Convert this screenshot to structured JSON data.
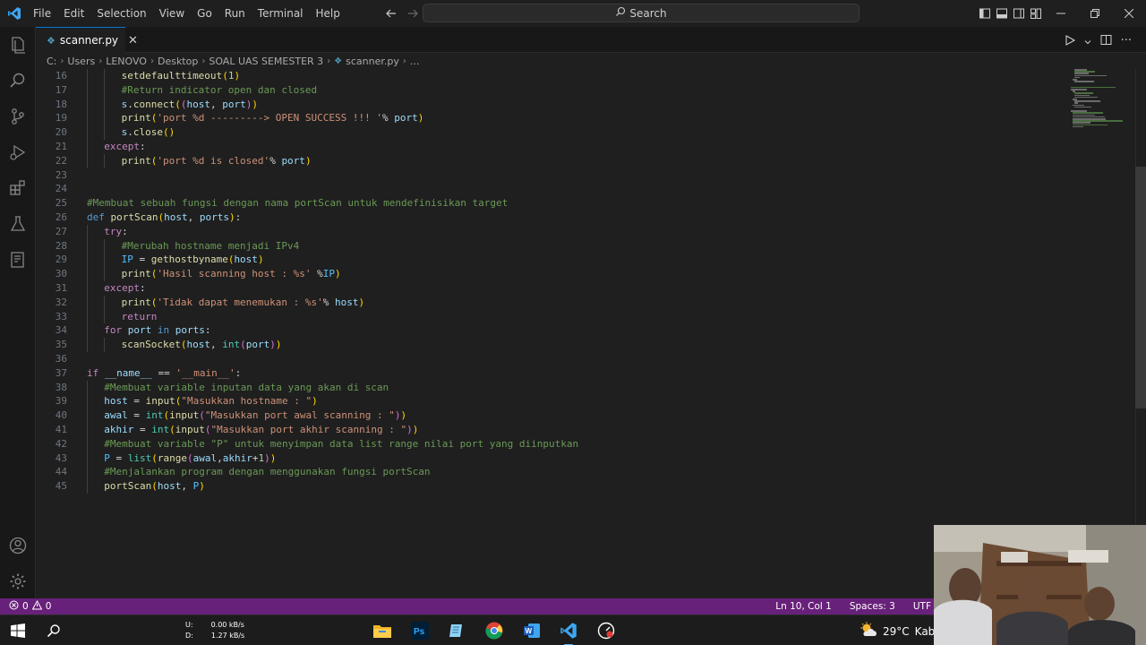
{
  "app": {
    "menu": [
      "File",
      "Edit",
      "Selection",
      "View",
      "Go",
      "Run",
      "Terminal",
      "Help"
    ],
    "search_label": "Search"
  },
  "tab": {
    "filename": "scanner.py"
  },
  "breadcrumb": [
    "C:",
    "Users",
    "LENOVO",
    "Desktop",
    "SOAL UAS SEMESTER 3",
    "scanner.py",
    "..."
  ],
  "code_lines": [
    {
      "n": "16",
      "indent": 2,
      "tokens": [
        [
          "fn",
          "setdefaulttimeout"
        ],
        [
          "p1",
          "("
        ],
        [
          "num",
          "1"
        ],
        [
          "p1",
          ")"
        ]
      ]
    },
    {
      "n": "17",
      "indent": 2,
      "tokens": [
        [
          "cmt",
          "#Return indicator open dan closed"
        ]
      ]
    },
    {
      "n": "18",
      "indent": 2,
      "tokens": [
        [
          "var",
          "s"
        ],
        [
          "d",
          "."
        ],
        [
          "fn",
          "connect"
        ],
        [
          "p1",
          "("
        ],
        [
          "p2",
          "("
        ],
        [
          "var",
          "host"
        ],
        [
          "d",
          ", "
        ],
        [
          "var",
          "port"
        ],
        [
          "p2",
          ")"
        ],
        [
          "p1",
          ")"
        ]
      ]
    },
    {
      "n": "19",
      "indent": 2,
      "tokens": [
        [
          "fn",
          "print"
        ],
        [
          "p1",
          "("
        ],
        [
          "str",
          "'port %d ---------> OPEN SUCCESS !!! '"
        ],
        [
          "d",
          "% "
        ],
        [
          "var",
          "port"
        ],
        [
          "p1",
          ")"
        ]
      ]
    },
    {
      "n": "20",
      "indent": 2,
      "tokens": [
        [
          "var",
          "s"
        ],
        [
          "d",
          "."
        ],
        [
          "fn",
          "close"
        ],
        [
          "p1",
          "()"
        ]
      ]
    },
    {
      "n": "21",
      "indent": 1,
      "tokens": [
        [
          "kw",
          "except"
        ],
        [
          "d",
          ":"
        ]
      ]
    },
    {
      "n": "22",
      "indent": 2,
      "tokens": [
        [
          "fn",
          "print"
        ],
        [
          "p1",
          "("
        ],
        [
          "str",
          "'port %d is closed'"
        ],
        [
          "d",
          "% "
        ],
        [
          "var",
          "port"
        ],
        [
          "p1",
          ")"
        ]
      ]
    },
    {
      "n": "23",
      "indent": 0,
      "tokens": []
    },
    {
      "n": "24",
      "indent": 0,
      "tokens": []
    },
    {
      "n": "25",
      "indent": 0,
      "tokens": [
        [
          "cmt",
          "#Membuat sebuah fungsi dengan nama portScan untuk mendefinisikan target"
        ]
      ]
    },
    {
      "n": "26",
      "indent": 0,
      "tokens": [
        [
          "kw2",
          "def "
        ],
        [
          "fn",
          "portScan"
        ],
        [
          "p1",
          "("
        ],
        [
          "var",
          "host"
        ],
        [
          "d",
          ", "
        ],
        [
          "var",
          "ports"
        ],
        [
          "p1",
          ")"
        ],
        [
          "d",
          ":"
        ]
      ]
    },
    {
      "n": "27",
      "indent": 1,
      "tokens": [
        [
          "kw",
          "try"
        ],
        [
          "d",
          ":"
        ]
      ]
    },
    {
      "n": "28",
      "indent": 2,
      "tokens": [
        [
          "cmt",
          "#Merubah hostname menjadi IPv4"
        ]
      ]
    },
    {
      "n": "29",
      "indent": 2,
      "tokens": [
        [
          "const",
          "IP"
        ],
        [
          "d",
          " = "
        ],
        [
          "fn",
          "gethostbyname"
        ],
        [
          "p1",
          "("
        ],
        [
          "var",
          "host"
        ],
        [
          "p1",
          ")"
        ]
      ]
    },
    {
      "n": "30",
      "indent": 2,
      "tokens": [
        [
          "fn",
          "print"
        ],
        [
          "p1",
          "("
        ],
        [
          "str",
          "'Hasil scanning host : %s'"
        ],
        [
          "d",
          " %"
        ],
        [
          "const",
          "IP"
        ],
        [
          "p1",
          ")"
        ]
      ]
    },
    {
      "n": "31",
      "indent": 1,
      "tokens": [
        [
          "kw",
          "except"
        ],
        [
          "d",
          ":"
        ]
      ]
    },
    {
      "n": "32",
      "indent": 2,
      "tokens": [
        [
          "fn",
          "print"
        ],
        [
          "p1",
          "("
        ],
        [
          "str",
          "'Tidak dapat menemukan : %s'"
        ],
        [
          "d",
          "% "
        ],
        [
          "var",
          "host"
        ],
        [
          "p1",
          ")"
        ]
      ]
    },
    {
      "n": "33",
      "indent": 2,
      "tokens": [
        [
          "kw",
          "return"
        ]
      ]
    },
    {
      "n": "34",
      "indent": 1,
      "tokens": [
        [
          "kw",
          "for "
        ],
        [
          "var",
          "port"
        ],
        [
          "kw2",
          " in "
        ],
        [
          "var",
          "ports"
        ],
        [
          "d",
          ":"
        ]
      ]
    },
    {
      "n": "35",
      "indent": 2,
      "tokens": [
        [
          "fn",
          "scanSocket"
        ],
        [
          "p1",
          "("
        ],
        [
          "var",
          "host"
        ],
        [
          "d",
          ", "
        ],
        [
          "cls",
          "int"
        ],
        [
          "p2",
          "("
        ],
        [
          "var",
          "port"
        ],
        [
          "p2",
          ")"
        ],
        [
          "p1",
          ")"
        ]
      ]
    },
    {
      "n": "36",
      "indent": 0,
      "tokens": []
    },
    {
      "n": "37",
      "indent": 0,
      "tokens": [
        [
          "kw",
          "if "
        ],
        [
          "var",
          "__name__"
        ],
        [
          "d",
          " == "
        ],
        [
          "str",
          "'__main__'"
        ],
        [
          "d",
          ":"
        ]
      ]
    },
    {
      "n": "38",
      "indent": 1,
      "tokens": [
        [
          "cmt",
          "#Membuat variable inputan data yang akan di scan"
        ]
      ]
    },
    {
      "n": "39",
      "indent": 1,
      "tokens": [
        [
          "var",
          "host"
        ],
        [
          "d",
          " = "
        ],
        [
          "fn",
          "input"
        ],
        [
          "p1",
          "("
        ],
        [
          "str",
          "\"Masukkan hostname : \""
        ],
        [
          "p1",
          ")"
        ]
      ]
    },
    {
      "n": "40",
      "indent": 1,
      "tokens": [
        [
          "var",
          "awal"
        ],
        [
          "d",
          " = "
        ],
        [
          "cls",
          "int"
        ],
        [
          "p1",
          "("
        ],
        [
          "fn",
          "input"
        ],
        [
          "p2",
          "("
        ],
        [
          "str",
          "\"Masukkan port awal scanning : \""
        ],
        [
          "p2",
          ")"
        ],
        [
          "p1",
          ")"
        ]
      ]
    },
    {
      "n": "41",
      "indent": 1,
      "tokens": [
        [
          "var",
          "akhir"
        ],
        [
          "d",
          " = "
        ],
        [
          "cls",
          "int"
        ],
        [
          "p1",
          "("
        ],
        [
          "fn",
          "input"
        ],
        [
          "p2",
          "("
        ],
        [
          "str",
          "\"Masukkan port akhir scanning : \""
        ],
        [
          "p2",
          ")"
        ],
        [
          "p1",
          ")"
        ]
      ]
    },
    {
      "n": "42",
      "indent": 1,
      "tokens": [
        [
          "cmt",
          "#Membuat variable \"P\" untuk menyimpan data list range nilai port yang diinputkan"
        ]
      ]
    },
    {
      "n": "43",
      "indent": 1,
      "tokens": [
        [
          "const",
          "P"
        ],
        [
          "d",
          " = "
        ],
        [
          "cls",
          "list"
        ],
        [
          "p1",
          "("
        ],
        [
          "fn",
          "range"
        ],
        [
          "p2",
          "("
        ],
        [
          "var",
          "awal"
        ],
        [
          "d",
          ","
        ],
        [
          "var",
          "akhir"
        ],
        [
          "d",
          "+"
        ],
        [
          "num",
          "1"
        ],
        [
          "p2",
          ")"
        ],
        [
          "p1",
          ")"
        ]
      ]
    },
    {
      "n": "44",
      "indent": 1,
      "tokens": [
        [
          "cmt",
          "#Menjalankan program dengan menggunakan fungsi portScan"
        ]
      ]
    },
    {
      "n": "45",
      "indent": 1,
      "tokens": [
        [
          "fn",
          "portScan"
        ],
        [
          "p1",
          "("
        ],
        [
          "var",
          "host"
        ],
        [
          "d",
          ", "
        ],
        [
          "const",
          "P"
        ],
        [
          "p1",
          ")"
        ]
      ]
    }
  ],
  "status": {
    "problems": "0",
    "warnings": "0",
    "position": "Ln 10, Col 1",
    "spaces": "Spaces: 3",
    "encoding": "UTF"
  },
  "taskbar": {
    "net_up_label": "U:",
    "net_up_value": "0.00 kB/s",
    "net_down_label": "D:",
    "net_down_value": "1.27 kB/s",
    "temperature": "29°C",
    "weather_text": "Kabu"
  },
  "colors": {
    "accent": "#0078d4",
    "statusbar": "#68217a",
    "editor_bg": "#1f1f1f"
  }
}
